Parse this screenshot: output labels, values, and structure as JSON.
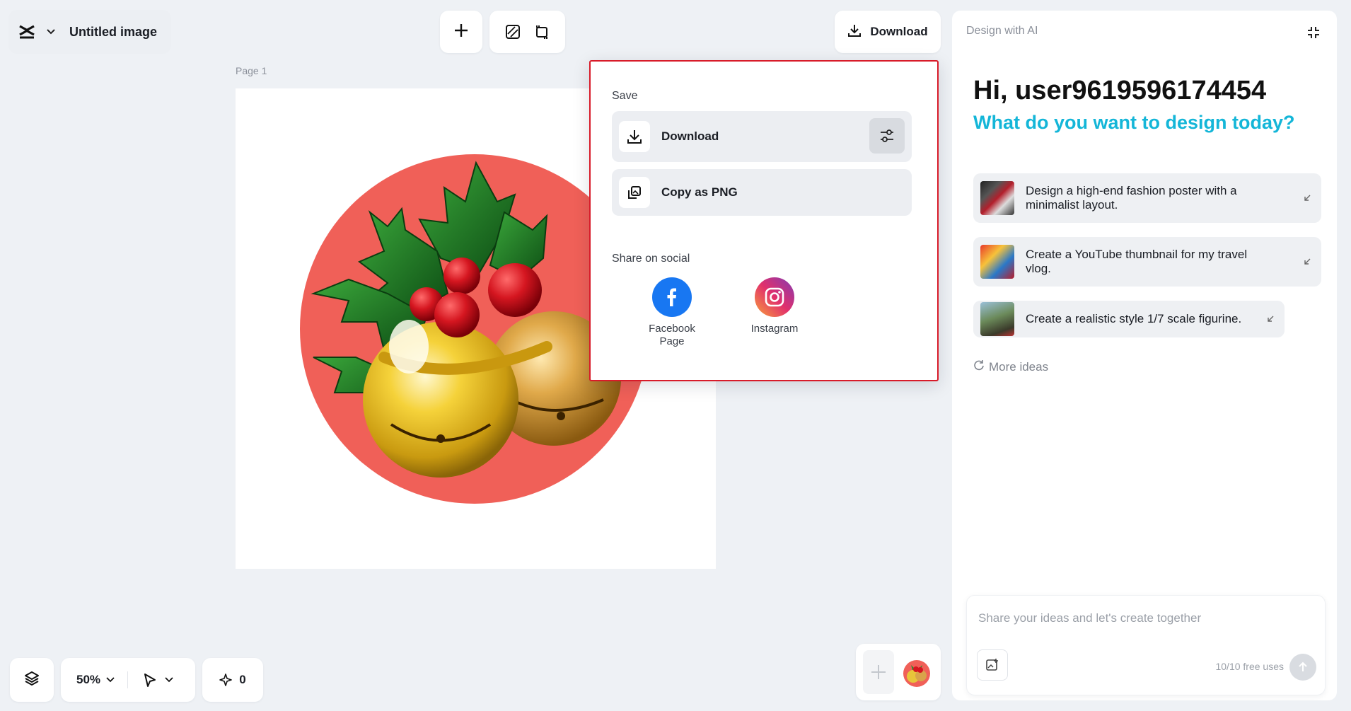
{
  "header": {
    "title": "Untitled image",
    "download_label": "Download",
    "icons": [
      "capcut-logo-icon",
      "chevron-down-icon",
      "plus-icon",
      "resize-icon",
      "crop-icon",
      "download-icon"
    ]
  },
  "canvas": {
    "page_label": "Page 1"
  },
  "download_menu": {
    "save_label": "Save",
    "download_label": "Download",
    "copy_png_label": "Copy as PNG",
    "share_label": "Share on social",
    "social": [
      {
        "name": "Facebook Page",
        "line1": "Facebook",
        "line2": "Page",
        "color": "#1877f2"
      },
      {
        "name": "Instagram",
        "line1": "Instagram",
        "line2": "",
        "color": "#e1306c"
      }
    ]
  },
  "ai_panel": {
    "header": "Design with AI",
    "greeting": "Hi, user9619596174454",
    "subtitle": "What do you want to design today?",
    "ideas": [
      {
        "line1": "Design a high-end fashion poster with a",
        "line2": "minimalist layout."
      },
      {
        "line1": "Create a YouTube thumbnail for my travel",
        "line2": "vlog."
      },
      {
        "line1": "Create a realistic style 1/7 scale figurine.",
        "line2": ""
      }
    ],
    "more_ideas": "More ideas",
    "input_placeholder": "Share your ideas and let's create together",
    "free_uses": "10/10 free uses"
  },
  "bottom_bar": {
    "zoom": "50%",
    "ai_count": "0"
  },
  "colors": {
    "accent_cyan": "#14b6d8",
    "highlight_border": "#d81b29",
    "art_circle": "#f06058"
  }
}
